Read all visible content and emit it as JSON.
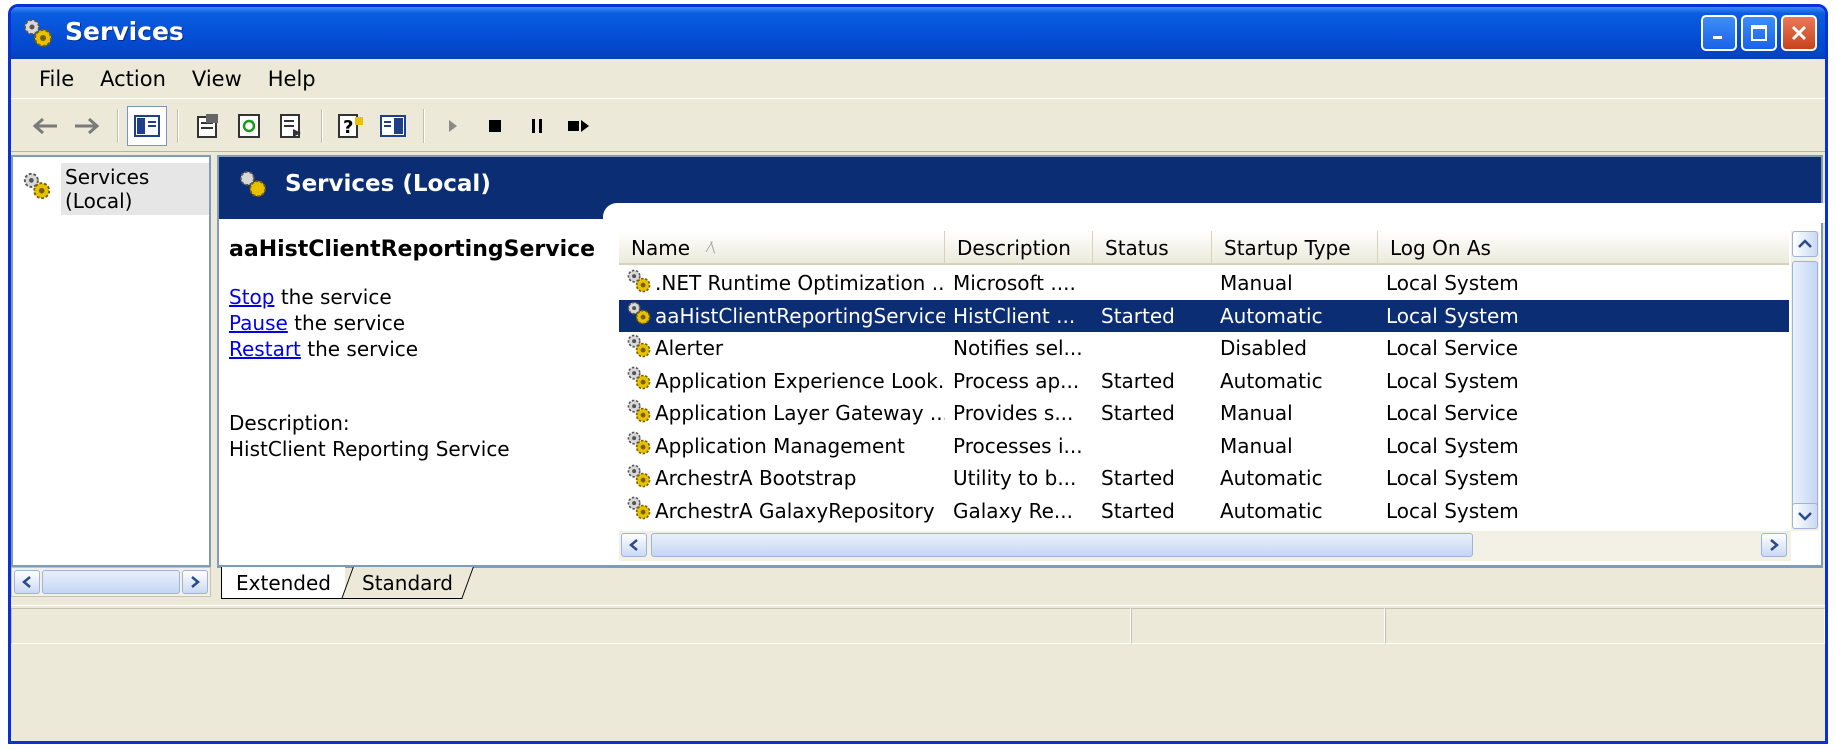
{
  "window": {
    "title": "Services"
  },
  "menubar": [
    {
      "label": "File"
    },
    {
      "label": "Action"
    },
    {
      "label": "View"
    },
    {
      "label": "Help"
    }
  ],
  "toolbar": {
    "icons": [
      "back-arrow-icon",
      "forward-arrow-icon",
      "show-hide-tree-icon",
      "properties-icon",
      "refresh-icon",
      "export-list-icon",
      "help-icon",
      "show-action-pane-icon",
      "start-service-icon",
      "stop-service-icon",
      "pause-service-icon",
      "restart-service-icon"
    ]
  },
  "tree": {
    "root_label": "Services (Local)"
  },
  "header": {
    "title": "Services (Local)"
  },
  "detail": {
    "service_name": "aaHistClientReportingService",
    "actions": [
      {
        "link": "Stop",
        "rest": " the service"
      },
      {
        "link": "Pause",
        "rest": " the service"
      },
      {
        "link": "Restart",
        "rest": " the service"
      }
    ],
    "description_label": "Description:",
    "description_text": "HistClient Reporting Service"
  },
  "list": {
    "columns": [
      "Name",
      "Description",
      "Status",
      "Startup Type",
      "Log On As"
    ],
    "sort_indicator": "⁄\\",
    "rows": [
      {
        "name": ".NET Runtime Optimization ...",
        "description": "Microsoft ....",
        "status": "",
        "startup": "Manual",
        "logon": "Local System"
      },
      {
        "name": "aaHistClientReportingService",
        "description": "HistClient ...",
        "status": "Started",
        "startup": "Automatic",
        "logon": "Local System",
        "selected": true
      },
      {
        "name": "Alerter",
        "description": "Notifies sel...",
        "status": "",
        "startup": "Disabled",
        "logon": "Local Service"
      },
      {
        "name": "Application Experience Look...",
        "description": "Process ap...",
        "status": "Started",
        "startup": "Automatic",
        "logon": "Local System"
      },
      {
        "name": "Application Layer Gateway ...",
        "description": "Provides s...",
        "status": "Started",
        "startup": "Manual",
        "logon": "Local Service"
      },
      {
        "name": "Application Management",
        "description": "Processes i...",
        "status": "",
        "startup": "Manual",
        "logon": "Local System"
      },
      {
        "name": "ArchestrA Bootstrap",
        "description": "Utility to b...",
        "status": "Started",
        "startup": "Automatic",
        "logon": "Local System"
      },
      {
        "name": "ArchestrA GalaxyRepository",
        "description": "Galaxy Re...",
        "status": "Started",
        "startup": "Automatic",
        "logon": "Local System"
      }
    ]
  },
  "tabs": {
    "extended": "Extended",
    "standard": "Standard"
  },
  "colors": {
    "titlebar": "#0550d8",
    "header_band": "#0b2d73",
    "selection": "#0b2d73",
    "chrome": "#ece9d8",
    "link": "#0000ee"
  }
}
